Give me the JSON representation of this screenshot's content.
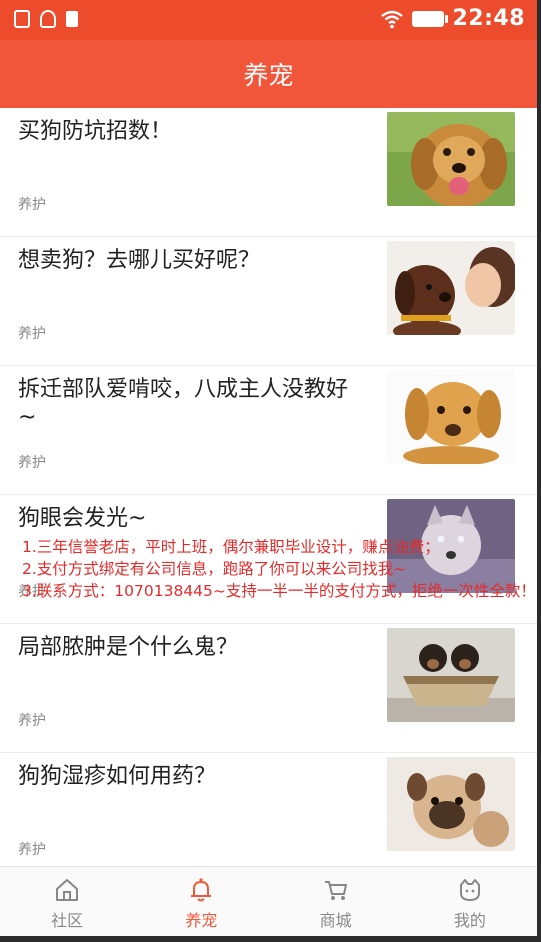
{
  "status_bar": {
    "time": "22:48",
    "icons": [
      "lock-icon",
      "nfc-icon",
      "clipboard-icon",
      "wifi-icon",
      "battery-icon"
    ]
  },
  "app_bar": {
    "title": "养宠"
  },
  "articles": [
    {
      "title": "买狗防坑招数！",
      "tag": "养护",
      "image": "golden-retriever-photo"
    },
    {
      "title": "想卖狗？去哪儿买好呢？",
      "tag": "养护",
      "image": "puppy-kiss-photo"
    },
    {
      "title": "拆迁部队爱啃咬，八成主人没教好~",
      "tag": "养护",
      "image": "labrador-puppy-photo"
    },
    {
      "title": "狗眼会发光~",
      "tag": "养护",
      "image": "glowing-eyes-dog-photo"
    },
    {
      "title": "局部脓肿是个什么鬼？",
      "tag": "养护",
      "image": "puppies-in-boat-photo"
    },
    {
      "title": "狗狗湿疹如何用药？",
      "tag": "养护",
      "image": "pug-puppy-photo"
    }
  ],
  "notice": {
    "line1": "1.三年信誉老店，平时上班，偶尔兼职毕业设计，赚点油费；",
    "line2": "2.支付方式绑定有公司信息，跑路了你可以来公司找我~",
    "line3": "3.联系方式：1070138445~支持一半一半的支付方式，拒绝一次性全款！"
  },
  "bottom_nav": [
    {
      "label": "社区",
      "icon": "home-icon",
      "active": false
    },
    {
      "label": "养宠",
      "icon": "bell-icon",
      "active": true
    },
    {
      "label": "商城",
      "icon": "cart-icon",
      "active": false
    },
    {
      "label": "我的",
      "icon": "profile-icon",
      "active": false
    }
  ],
  "colors": {
    "status_bar": "#ec4b2c",
    "app_bar": "#f1553a",
    "active_tab": "#ef5a3c",
    "notice_text": "#e42b2b"
  }
}
